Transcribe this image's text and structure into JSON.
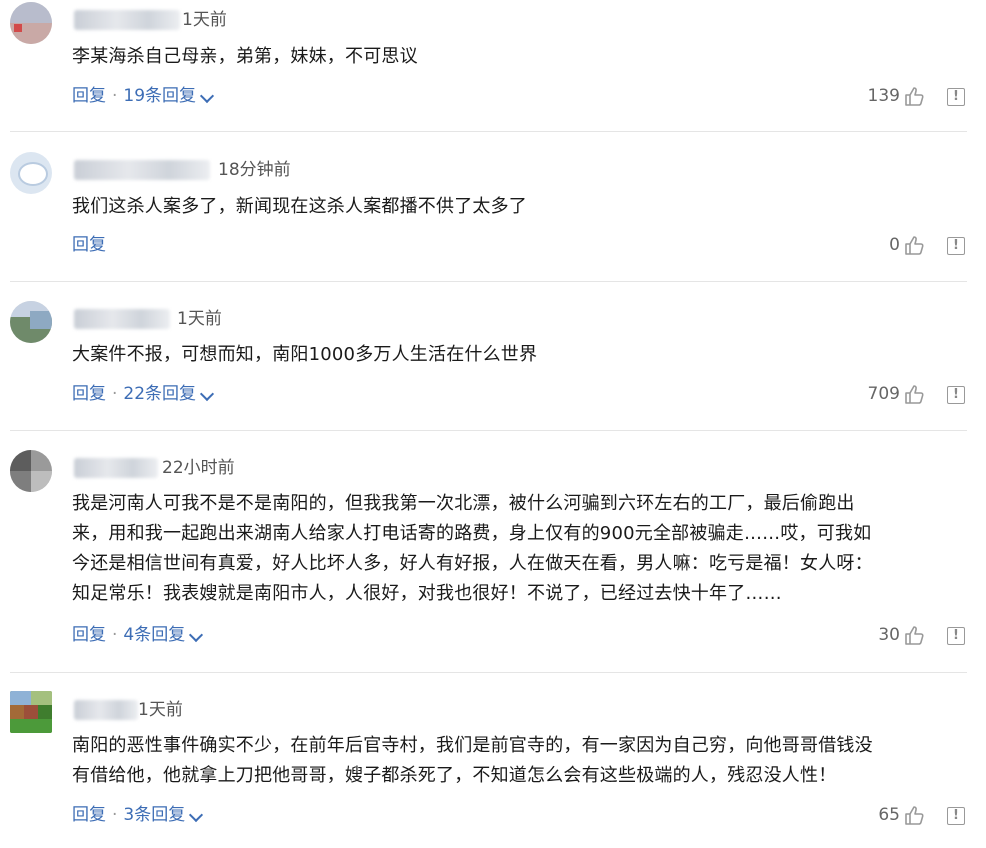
{
  "reply_label": "回复",
  "separator": "·",
  "comments": [
    {
      "time": "1天前",
      "text": "李某海杀自己母亲，弟第，妹妹，不可思议",
      "replies": "19条回复",
      "likes": "139"
    },
    {
      "time": "18分钟前",
      "text": "我们这杀人案多了，新闻现在这杀人案都播不供了太多了",
      "replies": "",
      "likes": "0"
    },
    {
      "time": "1天前",
      "text": "大案件不报，可想而知，南阳1000多万人生活在什么世界",
      "replies": "22条回复",
      "likes": "709"
    },
    {
      "time": "22小时前",
      "text_lines": [
        "我是河南人可我不是不是南阳的，但我我第一次北漂，被什么河骗到六环左右的工厂，最后偷跑出",
        "来，用和我一起跑出来湖南人给家人打电话寄的路费，身上仅有的900元全部被骗走……哎，可我如",
        "今还是相信世间有真爱，好人比坏人多，好人有好报，人在做天在看，男人嘛：吃亏是福！女人呀：",
        "知足常乐！我表嫂就是南阳市人，人很好，对我也很好！不说了，已经过去快十年了……"
      ],
      "replies": "4条回复",
      "likes": "30"
    },
    {
      "time": "1天前",
      "text_lines": [
        "南阳的恶性事件确实不少，在前年后官寺村，我们是前官寺的，有一家因为自己穷，向他哥哥借钱没",
        "有借给他，他就拿上刀把他哥哥，嫂子都杀死了，不知道怎么会有这些极端的人，残忍没人性！"
      ],
      "replies": "3条回复",
      "likes": "65"
    }
  ],
  "icons": {
    "like": "thumbs-up-icon",
    "report": "report-icon",
    "expand": "chevron-down-icon"
  },
  "colors": {
    "link": "#3d6db5",
    "text": "#1a1a1a",
    "meta": "#666666",
    "divider": "#e5e5e5"
  }
}
